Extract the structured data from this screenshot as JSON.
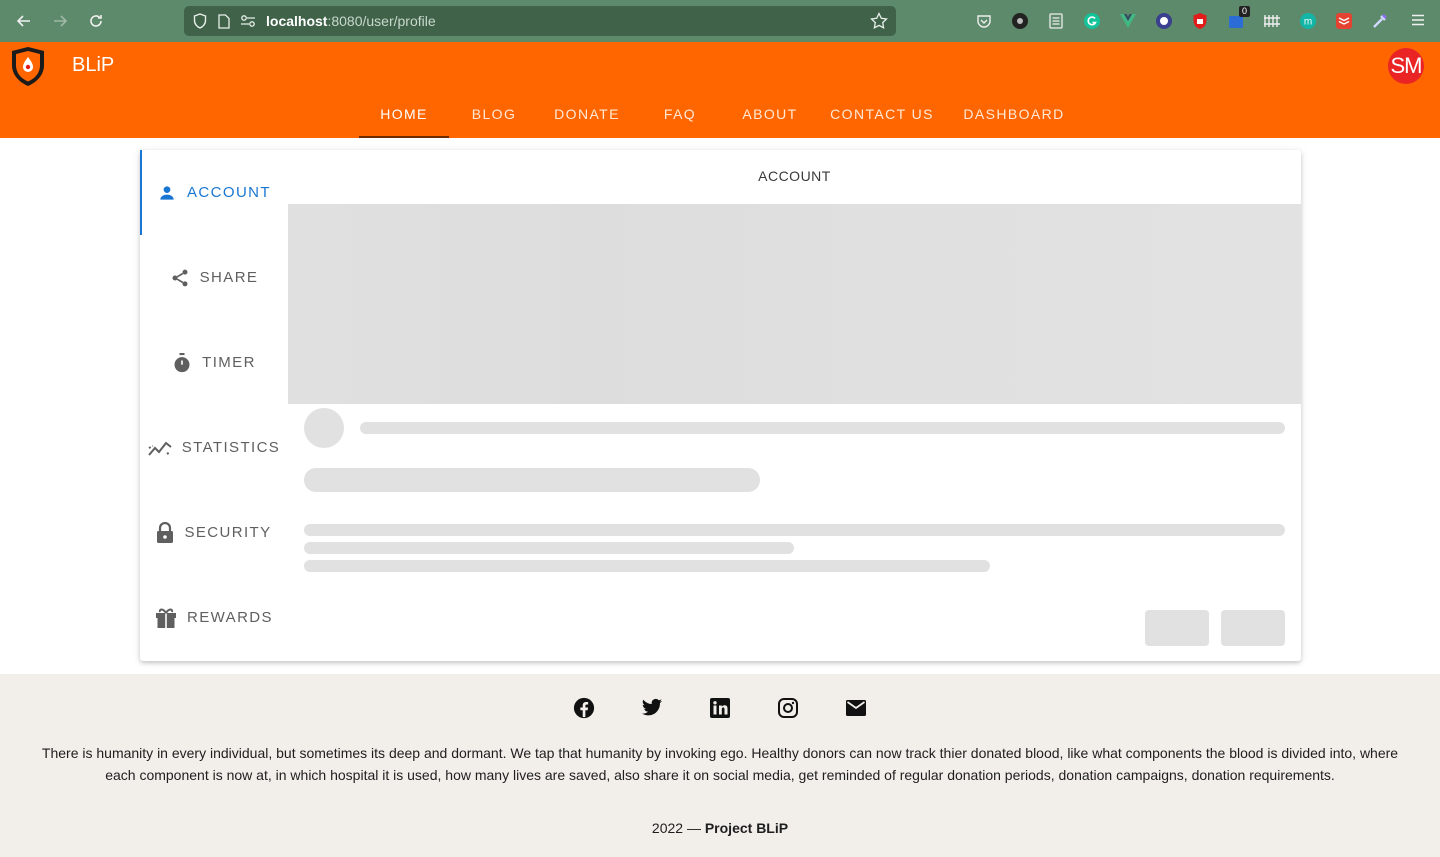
{
  "browser": {
    "url_host": "localhost",
    "url_rest": ":8080/user/profile",
    "extension_badge": "0"
  },
  "app": {
    "brand": "BLiP",
    "avatar_initials": "SM",
    "colors": {
      "header": "#ff6600",
      "accent": "#1976d2",
      "avatar": "#ea2424"
    },
    "tabs": [
      {
        "label": "Home",
        "active": true
      },
      {
        "label": "Blog"
      },
      {
        "label": "Donate"
      },
      {
        "label": "FAQ"
      },
      {
        "label": "About"
      },
      {
        "label": "Contact Us"
      },
      {
        "label": "Dashboard"
      }
    ]
  },
  "profile": {
    "panel_title": "ACCOUNT",
    "vertical_tabs": [
      {
        "label": "ACCOUNT",
        "icon": "person-icon",
        "active": true
      },
      {
        "label": "SHARE",
        "icon": "share-icon"
      },
      {
        "label": "TIMER",
        "icon": "timer-icon"
      },
      {
        "label": "STATISTICS",
        "icon": "statistics-icon"
      },
      {
        "label": "SECURITY",
        "icon": "lock-icon"
      },
      {
        "label": "REWARDS",
        "icon": "gift-icon"
      }
    ]
  },
  "footer": {
    "social": [
      "facebook-icon",
      "twitter-icon",
      "linkedin-icon",
      "instagram-icon",
      "email-icon"
    ],
    "description": "There is humanity in every individual, but sometimes its deep and dormant. We tap that humanity by invoking ego. Healthy donors can now track thier donated blood, like what components the blood is divided into, where each component is now at, in which hospital it is used, how many lives are saved, also share it on social media, get reminded of regular donation periods, donation campaigns, donation requirements.",
    "year": "2022 —",
    "project": "Project BLiP"
  }
}
